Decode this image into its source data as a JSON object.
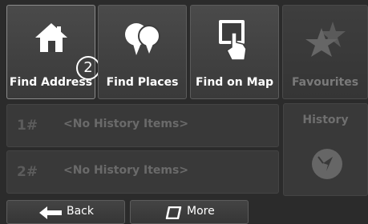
{
  "tiles": {
    "find_address": "Find Address",
    "find_places": "Find Places",
    "find_on_map": "Find on Map",
    "favourites": "Favourites"
  },
  "badge": "2",
  "history": {
    "label": "History",
    "rows": [
      {
        "num": "1#",
        "text": "<No History Items>"
      },
      {
        "num": "2#",
        "text": "<No History Items>"
      }
    ]
  },
  "bottom": {
    "back": "Back",
    "more": "More"
  },
  "icons": {
    "find_address": "home-icon",
    "find_places": "speech-balloons-icon",
    "find_on_map": "hand-tap-icon",
    "favourites": "stars-icon",
    "history": "compass-icon",
    "back": "arrow-left-icon",
    "more": "rounded-square-icon"
  }
}
